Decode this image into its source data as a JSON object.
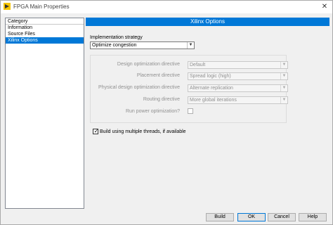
{
  "window": {
    "title": "FPGA Main Properties",
    "close_glyph": "✕"
  },
  "category": {
    "header": "Category",
    "items": [
      {
        "label": "Information"
      },
      {
        "label": "Source Files"
      },
      {
        "label": "Xilinx Options"
      }
    ],
    "selected": "Xilinx Options"
  },
  "main": {
    "banner": "Xilinx Options",
    "implementation_strategy_label": "Implementation strategy",
    "implementation_strategy_value": "Optimize congestion",
    "rows": [
      {
        "label": "Design optimization directive",
        "value": "Default"
      },
      {
        "label": "Placement directive",
        "value": "Spread logic (high)"
      },
      {
        "label": "Physical design optimization directive",
        "value": "Alternate replication"
      },
      {
        "label": "Routing directive",
        "value": "More global iterations"
      }
    ],
    "run_power_label": "Run power optimization?",
    "run_power_checked": false,
    "multithread_label": "Build using multiple threads, if available",
    "multithread_checked": true
  },
  "buttons": {
    "build": "Build",
    "ok": "OK",
    "cancel": "Cancel",
    "help": "Help"
  },
  "colors": {
    "accent": "#0078d7"
  },
  "icons": {
    "app": "fpga-app-icon",
    "dropdown": "chevron-down-icon",
    "check": "checkmark-icon"
  }
}
